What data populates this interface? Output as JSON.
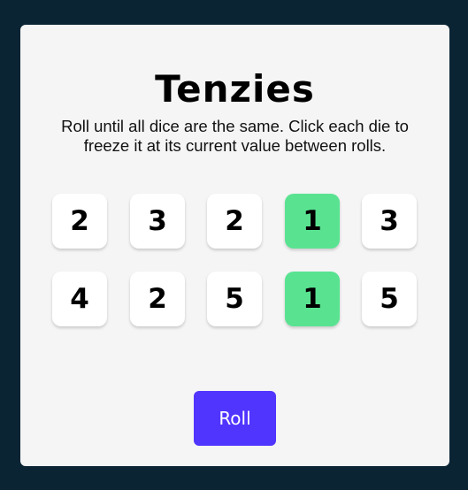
{
  "app": {
    "title": "Tenzies",
    "instructions": "Roll until all dice are the same. Click each die to freeze it at its current value between rolls."
  },
  "dice": [
    {
      "value": "2",
      "held": false
    },
    {
      "value": "3",
      "held": false
    },
    {
      "value": "2",
      "held": false
    },
    {
      "value": "1",
      "held": true
    },
    {
      "value": "3",
      "held": false
    },
    {
      "value": "4",
      "held": false
    },
    {
      "value": "2",
      "held": false
    },
    {
      "value": "5",
      "held": false
    },
    {
      "value": "1",
      "held": true
    },
    {
      "value": "5",
      "held": false
    }
  ],
  "roll_button": {
    "label": "Roll"
  },
  "colors": {
    "background": "#0b2434",
    "card": "#f5f5f5",
    "die": "#ffffff",
    "die_held": "#59e391",
    "button": "#5035ff"
  }
}
